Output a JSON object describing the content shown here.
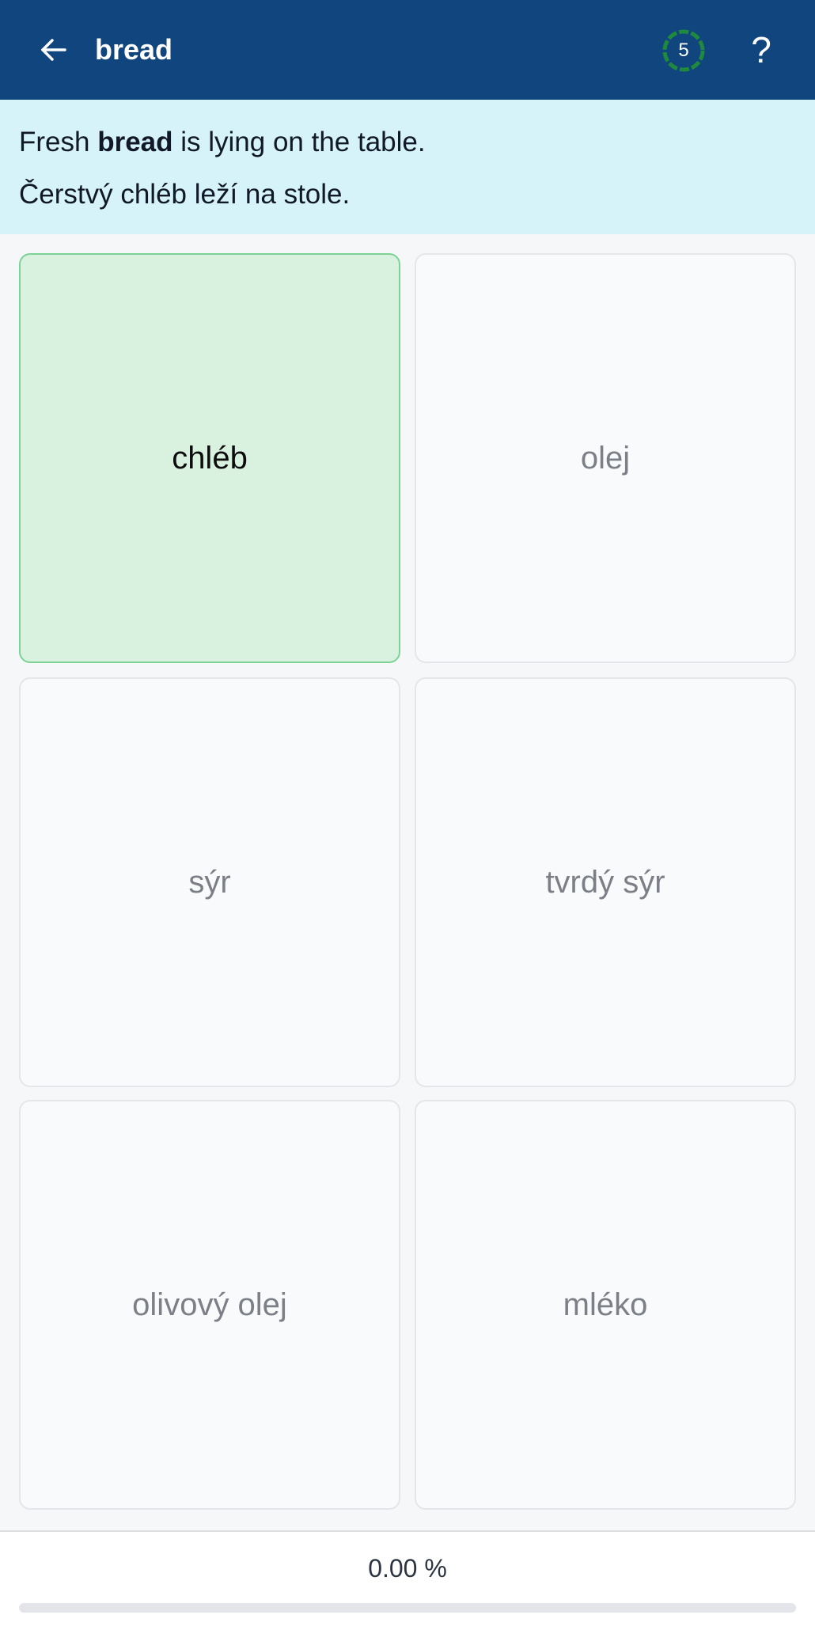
{
  "appbar": {
    "title": "bread",
    "timer_value": "5",
    "help_label": "?"
  },
  "sentence": {
    "english_prefix": "Fresh ",
    "english_keyword": "bread",
    "english_suffix": " is lying on the table.",
    "czech": "Čerstvý chléb leží na stole."
  },
  "options": [
    {
      "label": "chléb",
      "state": "correct"
    },
    {
      "label": "olej",
      "state": "default"
    },
    {
      "label": "sýr",
      "state": "default"
    },
    {
      "label": "tvrdý sýr",
      "state": "default"
    },
    {
      "label": "olivový olej",
      "state": "default"
    },
    {
      "label": "mléko",
      "state": "default"
    }
  ],
  "progress": {
    "label": "0.00 %",
    "fraction": 0.0
  },
  "colors": {
    "appbar": "#11457e",
    "timer_ring": "#1f8a3e",
    "sentence_bg": "#d5f3f8",
    "correct_bg": "#d9f1df",
    "correct_border": "#7dd296"
  }
}
